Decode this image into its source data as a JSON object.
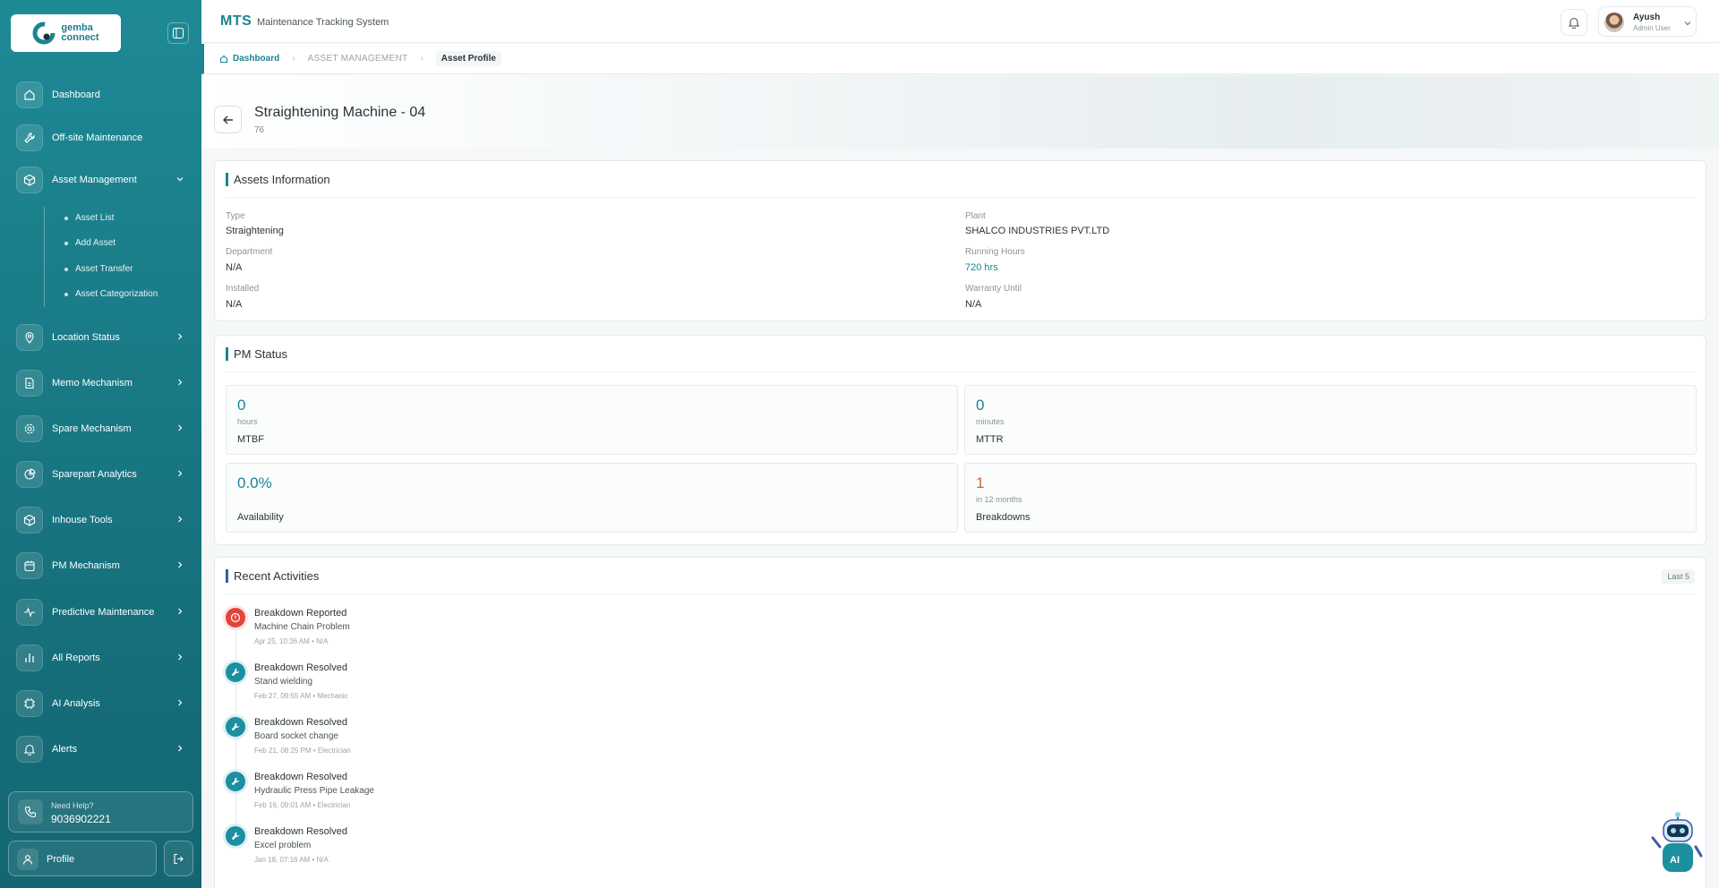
{
  "sidebar": {
    "logo_line1": "gemba",
    "logo_line2": "connect",
    "items": [
      {
        "label": "Dashboard",
        "icon": "home-icon"
      },
      {
        "label": "Off-site Maintenance",
        "icon": "wrench-icon"
      },
      {
        "label": "Asset Management",
        "icon": "box-icon",
        "expanded": true
      },
      {
        "label": "Location Status",
        "icon": "location-icon"
      },
      {
        "label": "Memo Mechanism",
        "icon": "file-icon"
      },
      {
        "label": "Spare Mechanism",
        "icon": "gear-icon"
      },
      {
        "label": "Sparepart Analytics",
        "icon": "pie-icon"
      },
      {
        "label": "Inhouse Tools",
        "icon": "box-icon"
      },
      {
        "label": "PM Mechanism",
        "icon": "calendar-icon"
      },
      {
        "label": "Predictive Maintenance",
        "icon": "pulse-icon"
      },
      {
        "label": "All Reports",
        "icon": "bar-chart-icon"
      },
      {
        "label": "AI Analysis",
        "icon": "cpu-icon"
      },
      {
        "label": "Alerts",
        "icon": "bell-icon"
      }
    ],
    "subitems": [
      "Asset List",
      "Add Asset",
      "Asset Transfer",
      "Asset Categorization"
    ],
    "help_title": "Need Help?",
    "help_phone": "9036902221",
    "profile_label": "Profile"
  },
  "header": {
    "brand": "MTS",
    "subtitle": "Maintenance Tracking System",
    "user_name": "Ayush",
    "user_role": "Admin User"
  },
  "breadcrumb": {
    "home": "Dashboard",
    "section": "ASSET MANAGEMENT",
    "current": "Asset Profile"
  },
  "asset": {
    "title": "Straightening Machine - 04",
    "id": "76"
  },
  "info": {
    "title": "Assets Information",
    "type_label": "Type",
    "type_value": "Straightening",
    "department_label": "Department",
    "department_value": "N/A",
    "installed_label": "Installed",
    "installed_value": "N/A",
    "plant_label": "Plant",
    "plant_value": "SHALCO INDUSTRIES PVT.LTD",
    "running_label": "Running Hours",
    "running_value": "720 hrs",
    "warranty_label": "Warranty Until",
    "warranty_value": "N/A"
  },
  "pm": {
    "title": "PM Status",
    "mtbf_value": "0",
    "mtbf_unit": "hours",
    "mtbf_label": "MTBF",
    "mttr_value": "0",
    "mttr_unit": "minutes",
    "mttr_label": "MTTR",
    "availability_value": "0.0%",
    "availability_label": "Availability",
    "breakdowns_value": "1",
    "breakdowns_unit": "in 12 months",
    "breakdowns_label": "Breakdowns"
  },
  "activities": {
    "title": "Recent Activities",
    "badge": "Last 5",
    "items": [
      {
        "title": "Breakdown Reported",
        "desc": "Machine Chain Problem",
        "meta": "Apr 25, 10:36 AM • N/A",
        "kind": "reported"
      },
      {
        "title": "Breakdown Resolved",
        "desc": "Stand wielding",
        "meta": "Feb 27, 09:55 AM • Mechanic",
        "kind": "resolved"
      },
      {
        "title": "Breakdown Resolved",
        "desc": "Board socket change",
        "meta": "Feb 21, 08:25 PM • Electrician",
        "kind": "resolved"
      },
      {
        "title": "Breakdown Resolved",
        "desc": "Hydraulic Press Pipe Leakage",
        "meta": "Feb 16, 09:01 AM • Electrician",
        "kind": "resolved"
      },
      {
        "title": "Breakdown Resolved",
        "desc": "Excel problem",
        "meta": "Jan 18, 07:16 AM • N/A",
        "kind": "resolved"
      }
    ]
  },
  "assistant": {
    "badge": "AI"
  },
  "colors": {
    "accent": "#1c8492",
    "danger": "#e0453b",
    "warning": "#d0662f"
  }
}
